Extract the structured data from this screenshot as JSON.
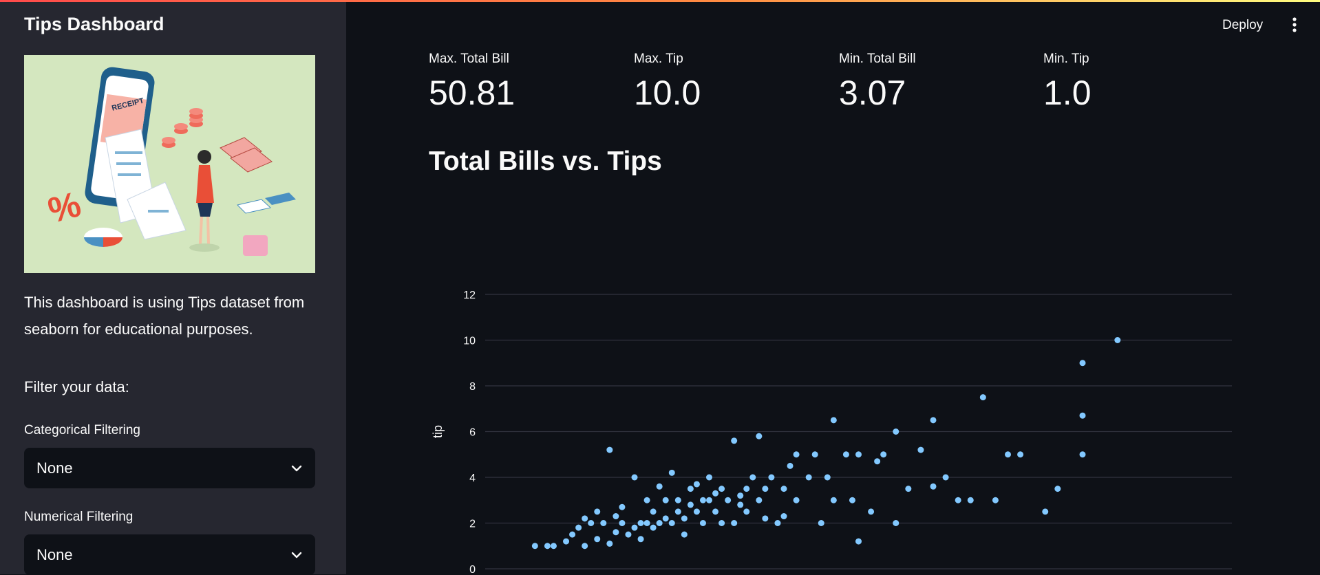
{
  "sidebar": {
    "title": "Tips Dashboard",
    "hero_text": "RECEIPT",
    "description": "This dashboard is using Tips dataset from seaborn for educational purposes.",
    "filter_heading": "Filter your data:",
    "categorical": {
      "label": "Categorical Filtering",
      "value": "None"
    },
    "numerical": {
      "label": "Numerical Filtering",
      "value": "None"
    }
  },
  "header": {
    "deploy_label": "Deploy"
  },
  "metrics": [
    {
      "label": "Max. Total Bill",
      "value": "50.81"
    },
    {
      "label": "Max. Tip",
      "value": "10.0"
    },
    {
      "label": "Min. Total Bill",
      "value": "3.07"
    },
    {
      "label": "Min. Tip",
      "value": "1.0"
    }
  ],
  "chart_title": "Total Bills vs. Tips",
  "chart_data": {
    "type": "scatter",
    "ylabel": "tip",
    "xlabel": "",
    "ylim": [
      0,
      12
    ],
    "yticks": [
      0,
      2,
      4,
      6,
      8,
      10,
      12
    ],
    "grid": true,
    "point_color": "#83c9ff",
    "points": [
      [
        4,
        1.0
      ],
      [
        5,
        1.0
      ],
      [
        5.5,
        1.0
      ],
      [
        6.5,
        1.2
      ],
      [
        7,
        1.5
      ],
      [
        8,
        1.0
      ],
      [
        9,
        1.3
      ],
      [
        10,
        1.1
      ],
      [
        7.5,
        1.8
      ],
      [
        8.5,
        2.0
      ],
      [
        9.5,
        2.0
      ],
      [
        10.5,
        1.6
      ],
      [
        11,
        2.0
      ],
      [
        12,
        1.8
      ],
      [
        12.5,
        2.0
      ],
      [
        13,
        2.0
      ],
      [
        13.5,
        2.5
      ],
      [
        14,
        2.0
      ],
      [
        14.5,
        3.0
      ],
      [
        15,
        2.0
      ],
      [
        15.5,
        3.0
      ],
      [
        16,
        2.2
      ],
      [
        16.5,
        3.5
      ],
      [
        17,
        2.5
      ],
      [
        17.5,
        3.0
      ],
      [
        18,
        3.0
      ],
      [
        18.5,
        2.5
      ],
      [
        19,
        3.5
      ],
      [
        19.5,
        3.0
      ],
      [
        20,
        2.0
      ],
      [
        20.5,
        3.2
      ],
      [
        21,
        3.5
      ],
      [
        21.5,
        4.0
      ],
      [
        22,
        3.0
      ],
      [
        22.5,
        3.5
      ],
      [
        23,
        4.0
      ],
      [
        23.5,
        2.0
      ],
      [
        24,
        3.5
      ],
      [
        24.5,
        4.5
      ],
      [
        25,
        3.0
      ],
      [
        26,
        4.0
      ],
      [
        26.5,
        5.0
      ],
      [
        27,
        2.0
      ],
      [
        27.5,
        4.0
      ],
      [
        28,
        3.0
      ],
      [
        29,
        5.0
      ],
      [
        29.5,
        3.0
      ],
      [
        30,
        5.0
      ],
      [
        31,
        2.5
      ],
      [
        31.5,
        4.7
      ],
      [
        32,
        5.0
      ],
      [
        33,
        6.0
      ],
      [
        34,
        3.5
      ],
      [
        35,
        5.2
      ],
      [
        36,
        6.5
      ],
      [
        37,
        4.0
      ],
      [
        38,
        3.0
      ],
      [
        39,
        3.0
      ],
      [
        40,
        7.5
      ],
      [
        41,
        3.0
      ],
      [
        42,
        5.0
      ],
      [
        43,
        5.0
      ],
      [
        45,
        2.5
      ],
      [
        46,
        3.5
      ],
      [
        48,
        5.0
      ],
      [
        48,
        6.7
      ],
      [
        48,
        9.0
      ],
      [
        50.81,
        10.0
      ],
      [
        10,
        5.2
      ],
      [
        12,
        4.0
      ],
      [
        15,
        4.2
      ],
      [
        18,
        4.0
      ],
      [
        28,
        6.5
      ],
      [
        20,
        5.6
      ],
      [
        22,
        5.8
      ],
      [
        25,
        5.0
      ],
      [
        30,
        1.2
      ],
      [
        33,
        2.0
      ],
      [
        36,
        3.6
      ],
      [
        16,
        1.5
      ],
      [
        9,
        2.5
      ],
      [
        11,
        2.7
      ],
      [
        13,
        3.0
      ],
      [
        14,
        3.6
      ],
      [
        17,
        3.7
      ],
      [
        19,
        2.0
      ],
      [
        21,
        2.5
      ],
      [
        24,
        2.3
      ],
      [
        11.5,
        1.5
      ],
      [
        12.5,
        1.3
      ],
      [
        13.5,
        1.8
      ],
      [
        14.5,
        2.2
      ],
      [
        15.5,
        2.5
      ],
      [
        16.5,
        2.8
      ],
      [
        17.5,
        2.0
      ],
      [
        18.5,
        3.3
      ],
      [
        20.5,
        2.8
      ],
      [
        22.5,
        2.2
      ],
      [
        10.5,
        2.3
      ],
      [
        8,
        2.2
      ]
    ]
  }
}
